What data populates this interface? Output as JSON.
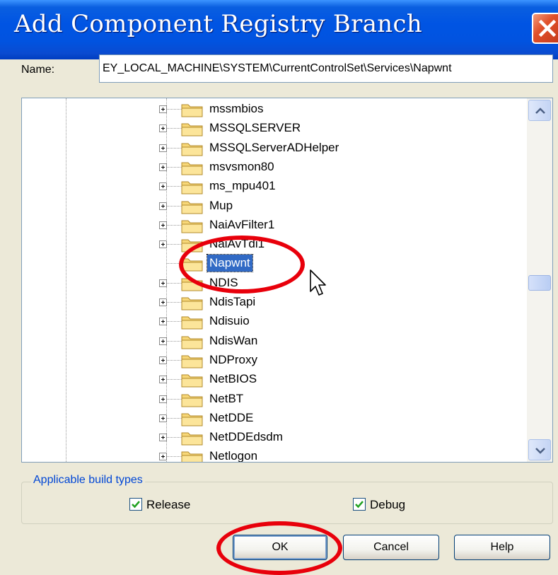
{
  "window": {
    "title": "Add Component Registry Branch",
    "close_icon": "close-icon",
    "close_color": "#e0502a"
  },
  "name_field": {
    "label": "Name:",
    "value": "EY_LOCAL_MACHINE\\SYSTEM\\CurrentControlSet\\Services\\Napwnt"
  },
  "tree": {
    "items": [
      {
        "label": "mssmbios",
        "expandable": true,
        "selected": false
      },
      {
        "label": "MSSQLSERVER",
        "expandable": true,
        "selected": false
      },
      {
        "label": "MSSQLServerADHelper",
        "expandable": true,
        "selected": false
      },
      {
        "label": "msvsmon80",
        "expandable": true,
        "selected": false
      },
      {
        "label": "ms_mpu401",
        "expandable": true,
        "selected": false
      },
      {
        "label": "Mup",
        "expandable": true,
        "selected": false
      },
      {
        "label": "NaiAvFilter1",
        "expandable": true,
        "selected": false
      },
      {
        "label": "NaiAvTdi1",
        "expandable": true,
        "selected": false
      },
      {
        "label": "Napwnt",
        "expandable": false,
        "selected": true
      },
      {
        "label": "NDIS",
        "expandable": true,
        "selected": false
      },
      {
        "label": "NdisTapi",
        "expandable": true,
        "selected": false
      },
      {
        "label": "Ndisuio",
        "expandable": true,
        "selected": false
      },
      {
        "label": "NdisWan",
        "expandable": true,
        "selected": false
      },
      {
        "label": "NDProxy",
        "expandable": true,
        "selected": false
      },
      {
        "label": "NetBIOS",
        "expandable": true,
        "selected": false
      },
      {
        "label": "NetBT",
        "expandable": true,
        "selected": false
      },
      {
        "label": "NetDDE",
        "expandable": true,
        "selected": false
      },
      {
        "label": "NetDDEdsdm",
        "expandable": true,
        "selected": false
      },
      {
        "label": "Netlogon",
        "expandable": true,
        "selected": false
      }
    ],
    "selection_color": "#316ac5"
  },
  "build_types": {
    "legend": "Applicable build types",
    "release": {
      "label": "Release",
      "checked": true
    },
    "debug": {
      "label": "Debug",
      "checked": true
    }
  },
  "buttons": {
    "ok": "OK",
    "cancel": "Cancel",
    "help": "Help"
  },
  "annotation_color": "#e8000b"
}
